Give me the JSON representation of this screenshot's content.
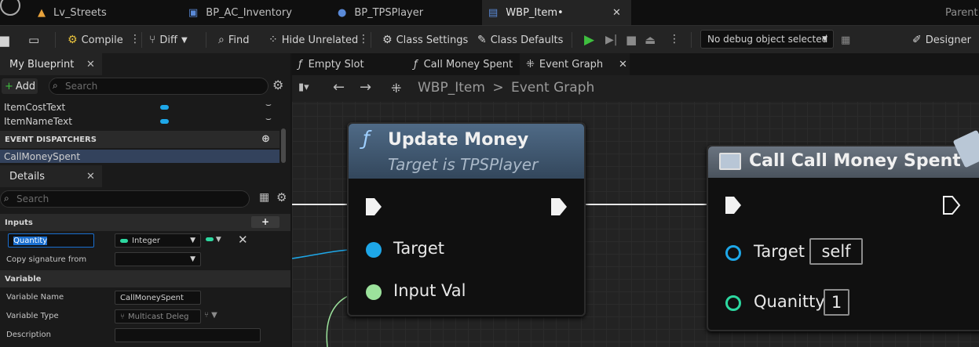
{
  "doc_tabs": [
    {
      "label": "Lv_Streets",
      "icon": "level-icon"
    },
    {
      "label": "BP_AC_Inventory",
      "icon": "component-icon"
    },
    {
      "label": "BP_TPSPlayer",
      "icon": "pawn-icon"
    },
    {
      "label": "WBP_Item•",
      "icon": "widget-blueprint-icon"
    }
  ],
  "parent_label": "Parent c",
  "toolbar": {
    "compile": "Compile",
    "diff": "Diff",
    "find": "Find",
    "hide_unrelated": "Hide Unrelated",
    "class_settings": "Class Settings",
    "class_defaults": "Class Defaults",
    "debug_object": "No debug object selected",
    "designer": "Designer"
  },
  "my_blueprint": {
    "tab": "My Blueprint",
    "add": "Add",
    "search_placeholder": "Search",
    "variables": [
      {
        "name": "ItemCostText",
        "type_color": "#1ea7e8"
      },
      {
        "name": "ItemNameText",
        "type_color": "#1ea7e8"
      }
    ],
    "event_dispatchers_header": "EVENT DISPATCHERS",
    "dispatchers": [
      "CallMoneySpent"
    ]
  },
  "details": {
    "tab": "Details",
    "search_placeholder": "Search",
    "inputs_header": "Inputs",
    "input_name": "Quantity",
    "input_type": "Integer",
    "copy_signature_label": "Copy signature from",
    "variable_header": "Variable",
    "variable_name_label": "Variable Name",
    "variable_name_value": "CallMoneySpent",
    "variable_type_label": "Variable Type",
    "variable_type_value": "Multicast Deleg",
    "description_label": "Description"
  },
  "graph_tabs": [
    {
      "label": "Empty Slot",
      "icon": "function-icon"
    },
    {
      "label": "Call Money Spent",
      "icon": "function-icon"
    },
    {
      "label": "Event Graph",
      "icon": "graph-icon"
    }
  ],
  "breadcrumb": {
    "root": "WBP_Item",
    "sep": ">",
    "current": "Event Graph"
  },
  "nodes": {
    "update_money": {
      "title": "Update Money",
      "subtitle": "Target is TPSPlayer",
      "pins": [
        "Target",
        "Input Val"
      ]
    },
    "call_money_spent": {
      "title": "Call Call Money Spent",
      "pins": [
        "Target",
        "Quanitty"
      ],
      "target_value": "self",
      "quantity_value": "1"
    }
  },
  "colors": {
    "integer_pin": "#2dd8a0",
    "object_pin": "#1ea7e8",
    "float_pin": "#9ce29c",
    "accent_play": "#3fbf3f"
  }
}
